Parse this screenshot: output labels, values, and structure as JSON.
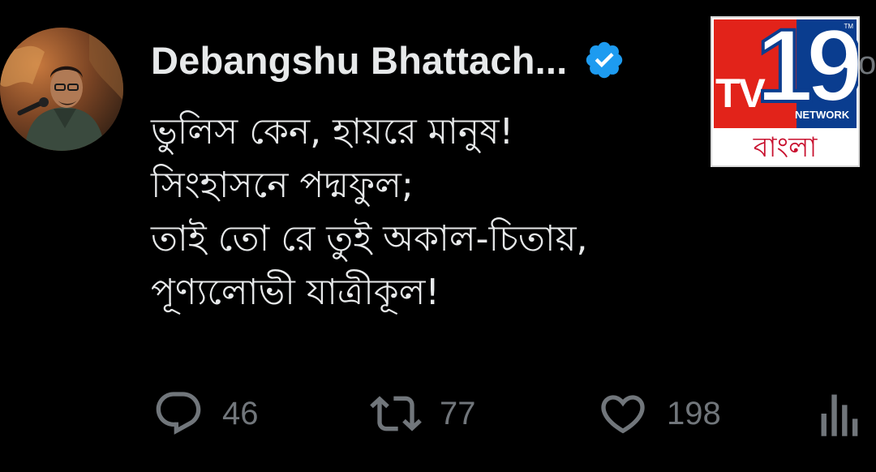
{
  "tweet": {
    "author": {
      "display_name": "Debangshu Bhattach...",
      "verified_icon": "verified-badge-icon",
      "avatar_icon": "profile-photo"
    },
    "more_glyph": "o",
    "lines": [
      "ভুলিস কেন, হায়রে মানুষ!",
      "সিংহাসনে পদ্মফুল;",
      "তাই তো রে তুই অকাল-চিতায়,",
      "পূণ্যলোভী যাত্রীকূল!"
    ],
    "actions": {
      "reply": {
        "icon": "reply-bubble-icon",
        "count": "46"
      },
      "retweet": {
        "icon": "retweet-icon",
        "count": "77"
      },
      "like": {
        "icon": "heart-icon",
        "count": "198"
      },
      "views": {
        "icon": "views-bar-chart-icon"
      }
    }
  },
  "watermark": {
    "brand_tv": "TV",
    "brand_number": "19",
    "brand_network": "NETWORK",
    "brand_tm": "TM",
    "brand_bengali": "বাংলা"
  },
  "colors": {
    "background": "#000000",
    "text_primary": "#e7e9ea",
    "text_secondary": "#71767b",
    "verified_blue": "#1d9bf0",
    "logo_red": "#e2231a",
    "logo_blue": "#0a3d8f"
  }
}
